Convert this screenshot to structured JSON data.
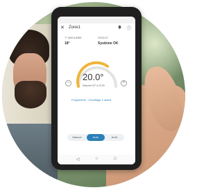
{
  "app": {
    "zone_title": "Zone1",
    "icons": {
      "close": "close-icon",
      "bell": "bell-icon",
      "info": "info-icon",
      "minus": "minus-icon",
      "plus": "plus-icon"
    },
    "stats": {
      "left_label": "T° MESURÉE",
      "left_value": "18°",
      "right_label": "STATUT",
      "right_value": "Système OK"
    },
    "temperature": "20.0°",
    "setpoint_text": "Setpoint 18° à 22:00",
    "program_text": "Programme : Chauffage 1 activé",
    "modes": [
      "Manuel",
      "Auto",
      "Arrêt"
    ],
    "selected_mode": "Auto",
    "colors": {
      "accent": "#2c7fb8",
      "arc": "#f0b43a"
    }
  }
}
